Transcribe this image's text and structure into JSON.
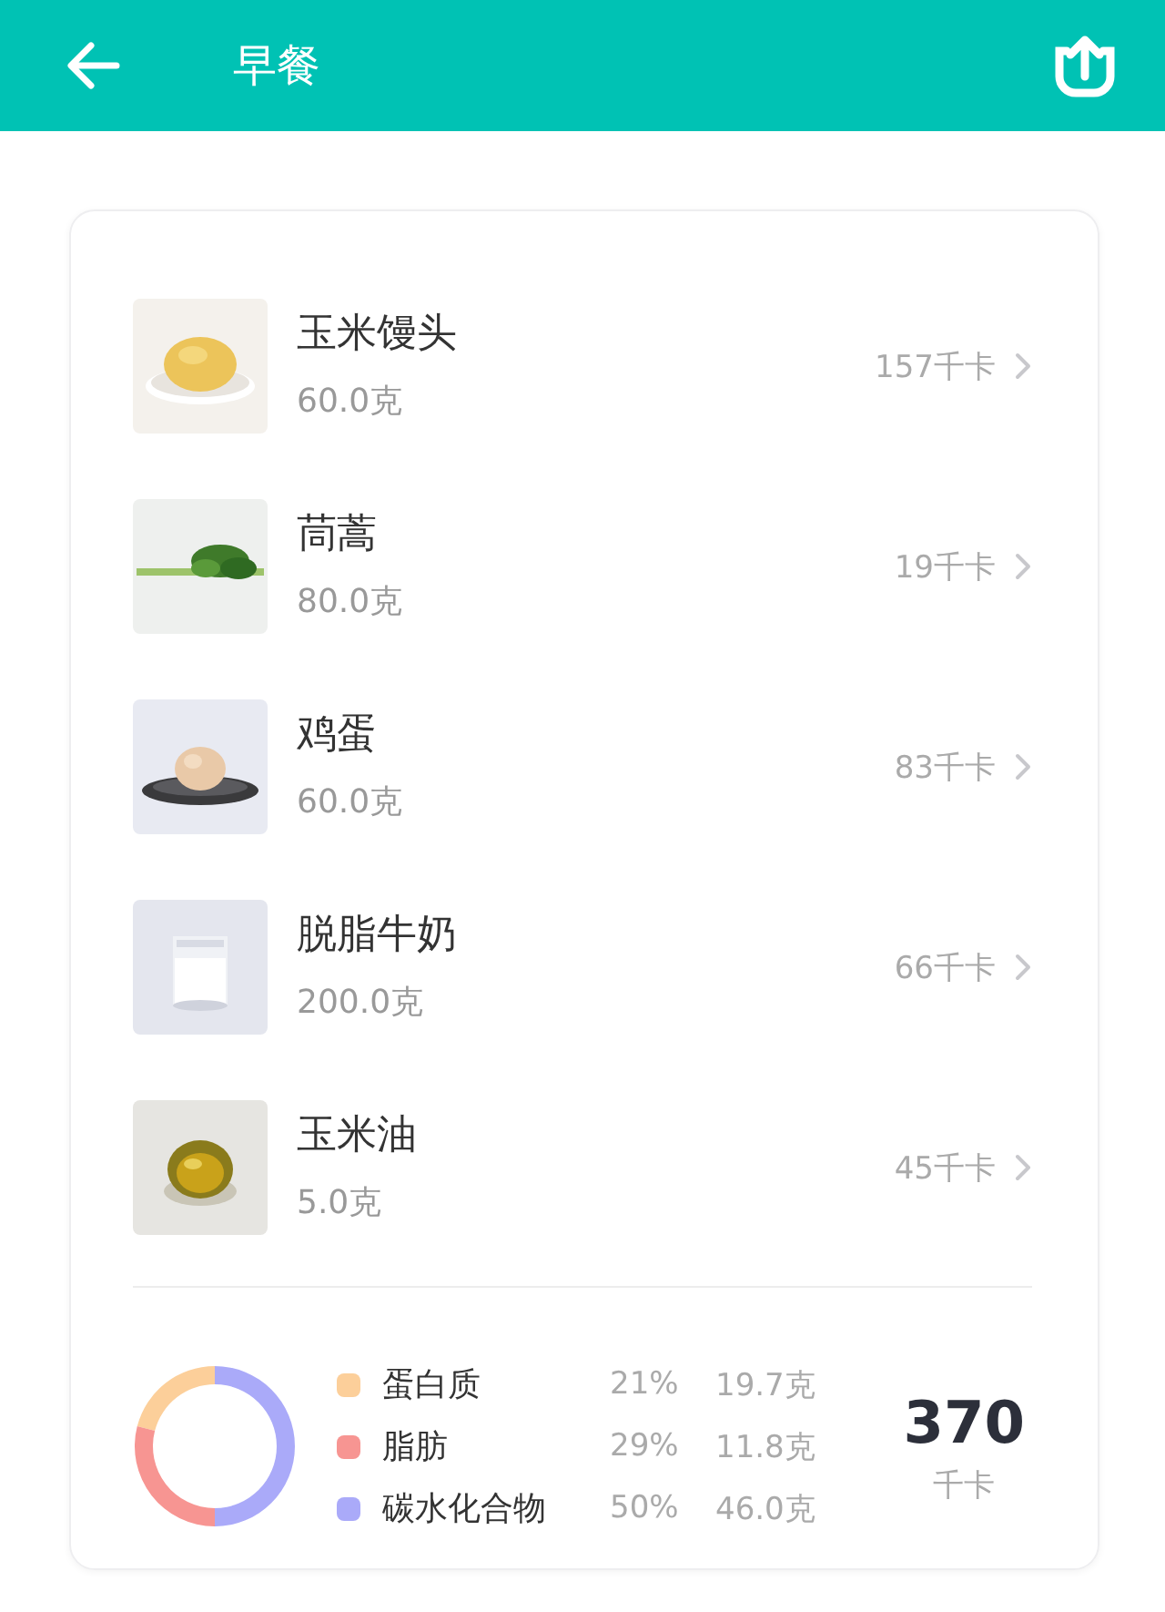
{
  "header": {
    "title": "早餐"
  },
  "foods": [
    {
      "name": "玉米馒头",
      "amount": "60.0克",
      "energy": "157千卡"
    },
    {
      "name": "茼蒿",
      "amount": "80.0克",
      "energy": "19千卡"
    },
    {
      "name": "鸡蛋",
      "amount": "60.0克",
      "energy": "83千卡"
    },
    {
      "name": "脱脂牛奶",
      "amount": "200.0克",
      "energy": "66千卡"
    },
    {
      "name": "玉米油",
      "amount": "5.0克",
      "energy": "45千卡"
    }
  ],
  "summary": {
    "chart_data": {
      "type": "donut",
      "categories": [
        "蛋白质",
        "脂肪",
        "碳水化合物"
      ],
      "values": [
        21,
        29,
        50
      ]
    },
    "nutrients": [
      {
        "percent": "21%",
        "amount": "19.7克",
        "color": "#fccf9a"
      },
      {
        "percent": "29%",
        "amount": "11.8克",
        "color": "#f79592"
      },
      {
        "percent": "50%",
        "amount": "46.0克",
        "color": "#aaaaf9"
      }
    ],
    "total": "370",
    "total_unit": "千卡"
  }
}
